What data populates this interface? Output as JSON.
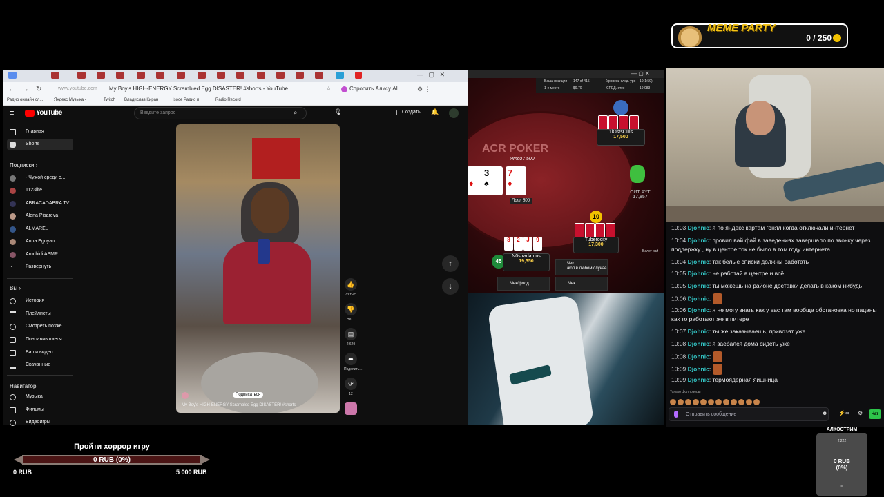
{
  "meme_widget": {
    "title": "MEME PARTY",
    "count": "0 / 250"
  },
  "browser": {
    "page_title": "My Boy's HIGH-ENERGY Scrambled Egg DISASTER! #shorts - YouTube",
    "url": "www.youtube.com",
    "alice_button": "Спросить Алису AI",
    "bookmarks": [
      "Радио онлайн сл...",
      "Яндекс Музыка -",
      "Twitch",
      "Владислав Киран",
      "Isoce Радио п",
      "Radio Record"
    ]
  },
  "youtube": {
    "logo": "YouTube",
    "search_placeholder": "Введите запрос",
    "create_label": "Создать",
    "sidebar": {
      "home": "Главная",
      "shorts": "Shorts",
      "subs_heading": "Подписки",
      "subs": [
        "- Чужой среди с...",
        "1123life",
        "ABRACADABRA TV",
        "Alena Pisareva",
        "ALMAREL",
        "Anna Egoyan",
        "Aruchidi ASMR"
      ],
      "expand": "Развернуть",
      "you_heading": "Вы",
      "you_items": [
        "История",
        "Плейлисты",
        "Смотреть позже",
        "Понравившиеся",
        "Ваши видео",
        "Скачанные"
      ],
      "nav_heading": "Навигатор",
      "nav_items": [
        "Музыка",
        "Фильмы",
        "Видеоигры"
      ]
    },
    "short": {
      "caption": "My Boy's HIGH-ENERGY Scrambled Egg DISASTER! #shorts",
      "subscribe": "Подписаться",
      "likes": "73 тыс.",
      "dislike": "Не ...",
      "comments": "2 629",
      "share": "Поделить...",
      "remix": "12"
    }
  },
  "poker": {
    "stats": [
      "Ваша позиция",
      "147 of 415",
      "1-е место",
      "$9.70",
      "Уровень след. уро",
      "10(1:59)",
      "СРЕД. стек",
      "19,083"
    ],
    "logo": "ACR POKER",
    "total": "Итог : 500",
    "pot": "Пот: 500",
    "board": [
      {
        "rank": "",
        "suit": "♦",
        "red": true
      },
      {
        "rank": "3",
        "suit": "♠",
        "red": false
      },
      {
        "rank": "7",
        "suit": "♦",
        "red": true
      }
    ],
    "players": [
      {
        "name": "1lOstsOuls",
        "stack": "17,500"
      },
      {
        "name": "СИТ АУТ",
        "stack": "17,857"
      },
      {
        "name": "Tuberocity",
        "stack": "17,300"
      },
      {
        "name": "N0stradamus",
        "stack": "19,350"
      }
    ],
    "hero_cards": [
      {
        "r": "8",
        "red": true
      },
      {
        "r": "2",
        "red": true
      },
      {
        "r": "J",
        "red": true
      },
      {
        "r": "9",
        "red": true
      }
    ],
    "bet": "10",
    "timebank": "45",
    "valet": "Валет хай",
    "buttons": [
      "Чек\n/кол в любом случае",
      "Чек/фолд",
      "Чек"
    ]
  },
  "chat": {
    "messages": [
      {
        "time": "10:03",
        "user": "Djohnic",
        "text": ": я по яндекс картам гонял когда отключали интернет"
      },
      {
        "time": "10:04",
        "user": "Djohnic",
        "text": ": провил вай фай в заведениях завершало по звонку через поддержку , ну в центре ток не было в том году интернета"
      },
      {
        "time": "10:04",
        "user": "Djohnic",
        "text": ": так белые списки должны работать"
      },
      {
        "time": "10:05",
        "user": "Djohnic",
        "text": ": не работай в центре и всё"
      },
      {
        "time": "10:05",
        "user": "Djohnic",
        "text": ": ты можешь на районе доставки делать в каком нибудь"
      },
      {
        "time": "10:06",
        "user": "Djohnic",
        "text": ":",
        "emote": true
      },
      {
        "time": "10:06",
        "user": "Djohnic",
        "text": ": я не могу знать как у вас там вообще обстановка но пацаны как то работают же в питере"
      },
      {
        "time": "10:07",
        "user": "Djohnic",
        "text": ": ты же заказываешь, привозят уже"
      },
      {
        "time": "10:08",
        "user": "Djohnic",
        "text": ": я заебался дома сидеть уже"
      },
      {
        "time": "10:08",
        "user": "Djohnic",
        "text": ":",
        "emote": true
      },
      {
        "time": "10:09",
        "user": "Djohnic",
        "text": ":",
        "emote": true
      },
      {
        "time": "10:09",
        "user": "Djohnic",
        "text": ": термоядерная яишница"
      }
    ],
    "followers_only": "Только фолловеры",
    "input_placeholder": "Отправить сообщение",
    "send_label": "Чат"
  },
  "goal": {
    "title": "Пройти хоррор игру",
    "value": "0 RUB (0%)",
    "min": "0 RUB",
    "max": "5 000 RUB",
    "progress": 0
  },
  "alko": {
    "title": "АЛКОСТРИМ",
    "top": "2 222",
    "value": "0 RUB\n(0%)",
    "bottom": "0"
  }
}
